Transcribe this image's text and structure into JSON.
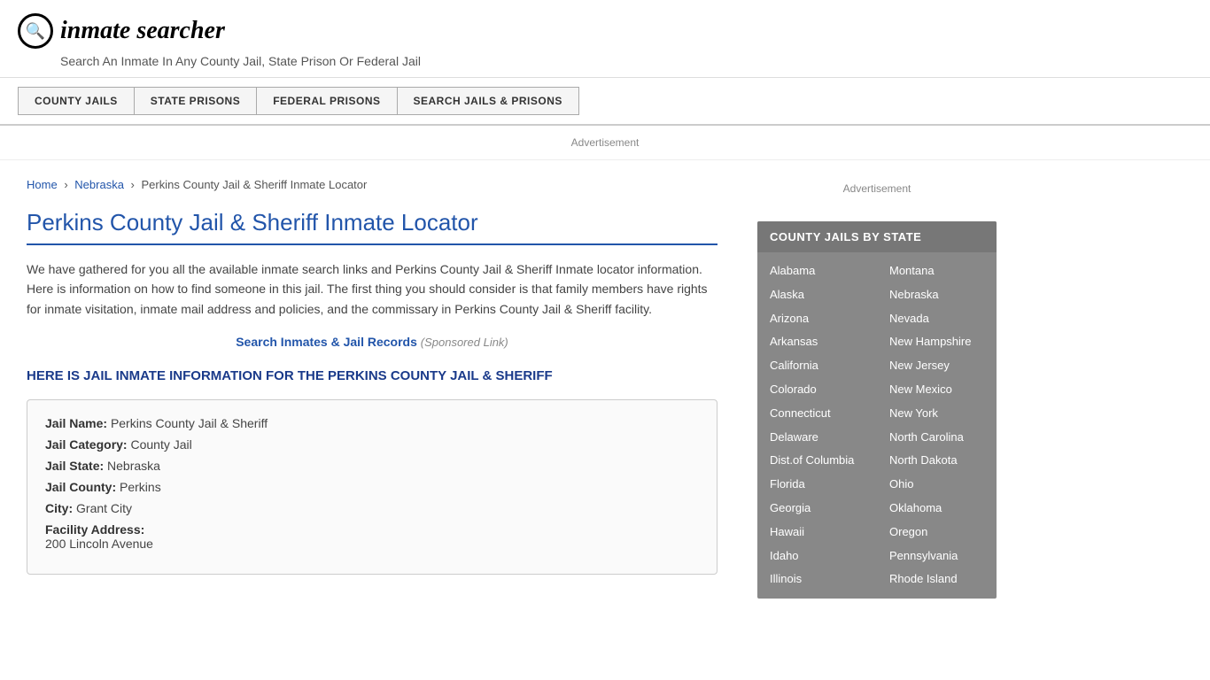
{
  "header": {
    "logo_icon": "🔍",
    "logo_text": "inmate searcher",
    "tagline": "Search An Inmate In Any County Jail, State Prison Or Federal Jail"
  },
  "nav": {
    "buttons": [
      {
        "id": "county-jails",
        "label": "COUNTY JAILS"
      },
      {
        "id": "state-prisons",
        "label": "STATE PRISONS"
      },
      {
        "id": "federal-prisons",
        "label": "FEDERAL PRISONS"
      },
      {
        "id": "search-jails",
        "label": "SEARCH JAILS & PRISONS"
      }
    ]
  },
  "ad_label": "Advertisement",
  "breadcrumb": {
    "home": "Home",
    "state": "Nebraska",
    "current": "Perkins County Jail & Sheriff Inmate Locator"
  },
  "page_title": "Perkins County Jail & Sheriff Inmate Locator",
  "description": "We have gathered for you all the available inmate search links and Perkins County Jail & Sheriff Inmate locator information. Here is information on how to find someone in this jail. The first thing you should consider is that family members have rights for inmate visitation, inmate mail address and policies, and the commissary in Perkins County Jail & Sheriff facility.",
  "search_link": {
    "text": "Search Inmates & Jail Records",
    "sponsored": "(Sponsored Link)"
  },
  "info_heading": "HERE IS JAIL INMATE INFORMATION FOR THE PERKINS COUNTY JAIL & SHERIFF",
  "jail_info": {
    "name_label": "Jail Name:",
    "name_value": "Perkins County Jail & Sheriff",
    "category_label": "Jail Category:",
    "category_value": "County Jail",
    "state_label": "Jail State:",
    "state_value": "Nebraska",
    "county_label": "Jail County:",
    "county_value": "Perkins",
    "city_label": "City:",
    "city_value": "Grant City",
    "address_label": "Facility Address:",
    "address_value": "200 Lincoln Avenue"
  },
  "sidebar": {
    "ad_label": "Advertisement",
    "county_jails_title": "COUNTY JAILS BY STATE",
    "states_left": [
      "Alabama",
      "Alaska",
      "Arizona",
      "Arkansas",
      "California",
      "Colorado",
      "Connecticut",
      "Delaware",
      "Dist.of Columbia",
      "Florida",
      "Georgia",
      "Hawaii",
      "Idaho",
      "Illinois"
    ],
    "states_right": [
      "Montana",
      "Nebraska",
      "Nevada",
      "New Hampshire",
      "New Jersey",
      "New Mexico",
      "New York",
      "North Carolina",
      "North Dakota",
      "Ohio",
      "Oklahoma",
      "Oregon",
      "Pennsylvania",
      "Rhode Island"
    ]
  }
}
